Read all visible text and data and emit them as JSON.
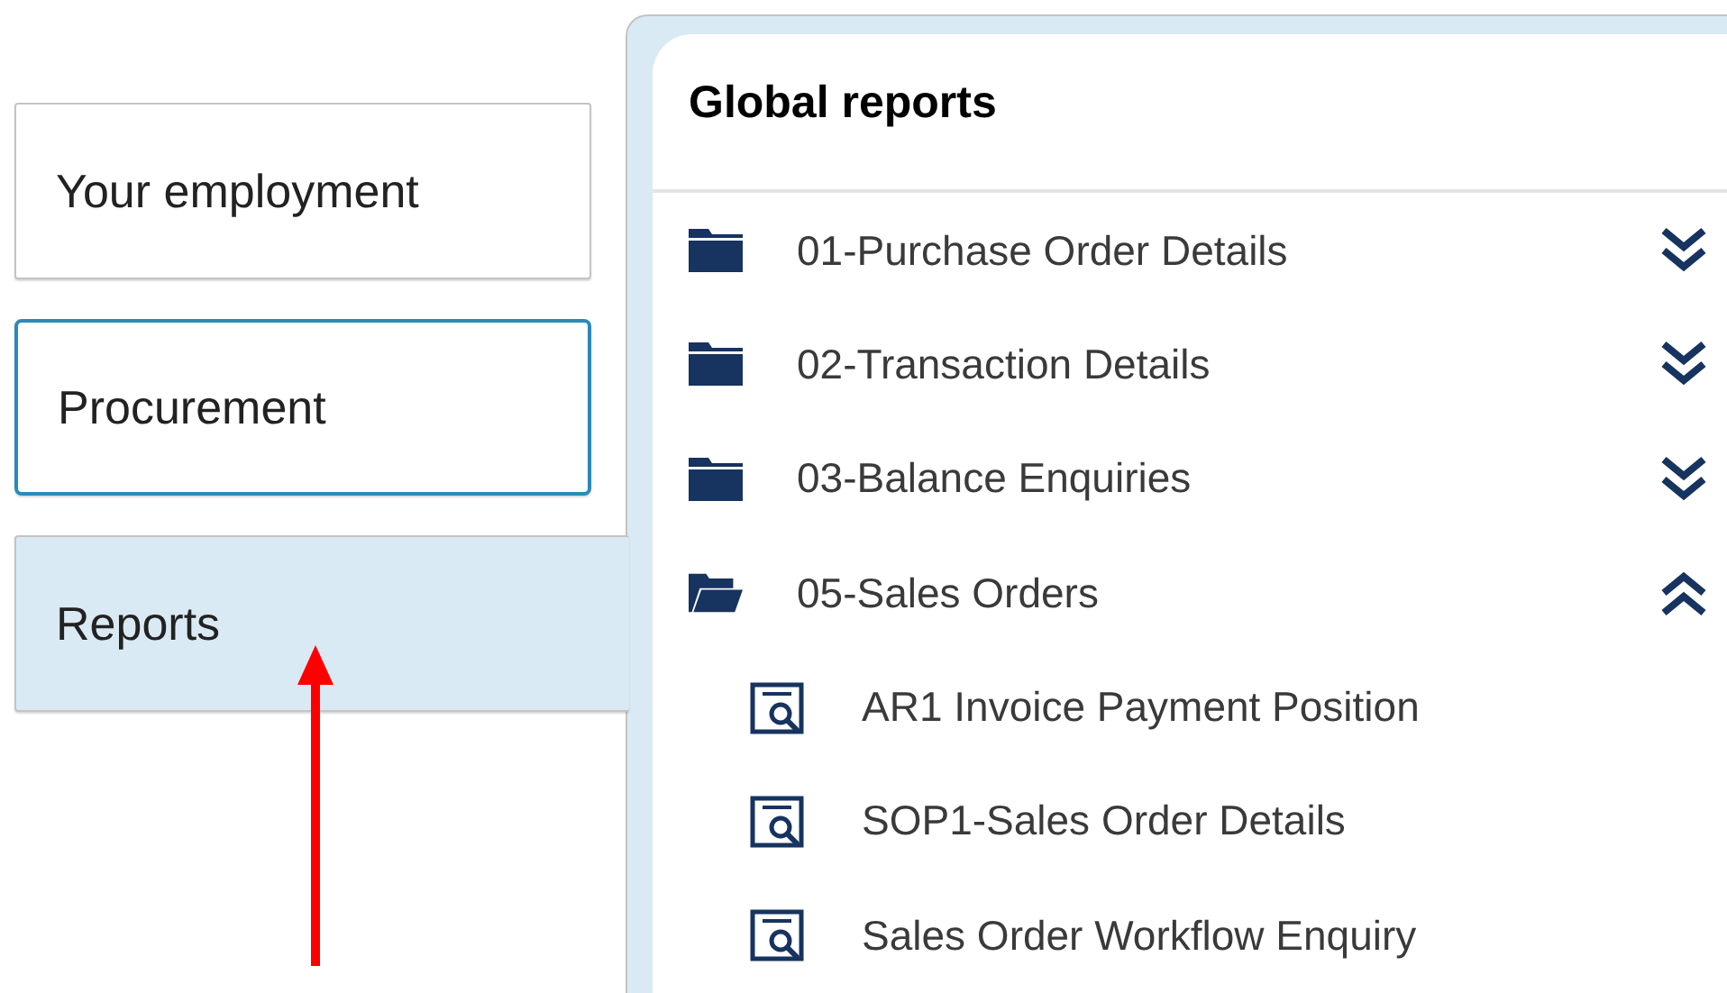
{
  "tabs": [
    {
      "label": "Your employment",
      "selected": false,
      "focused": false
    },
    {
      "label": "Procurement",
      "selected": false,
      "focused": true
    },
    {
      "label": "Reports",
      "selected": true,
      "focused": false
    }
  ],
  "panel": {
    "title": "Global reports",
    "folders": [
      {
        "name": "01-Purchase Order Details",
        "expanded": false
      },
      {
        "name": "02-Transaction Details",
        "expanded": false
      },
      {
        "name": "03-Balance Enquiries",
        "expanded": false
      },
      {
        "name": "05-Sales Orders",
        "expanded": true,
        "children": [
          {
            "name": "AR1 Invoice Payment Position"
          },
          {
            "name": "SOP1-Sales Order Details"
          },
          {
            "name": "Sales Order Workflow Enquiry"
          }
        ]
      }
    ]
  }
}
